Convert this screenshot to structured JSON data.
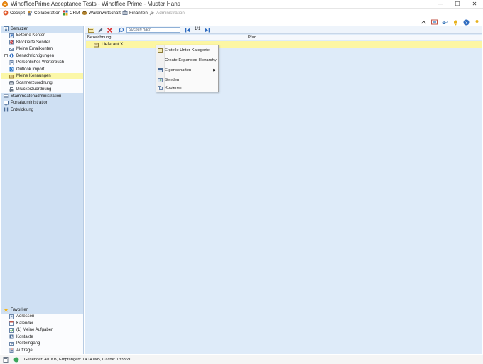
{
  "window": {
    "title": "WinofficePrime Acceptance Tests - Winoffice Prime - Muster Hans",
    "minimize": "—",
    "maximize": "☐",
    "close": "✕"
  },
  "modules": [
    {
      "label": "Cockpit",
      "icon": "cockpit-icon"
    },
    {
      "label": "Collaboration",
      "icon": "collaboration-icon"
    },
    {
      "label": "CRM",
      "icon": "crm-icon"
    },
    {
      "label": "Warenwirtschaft",
      "icon": "warenwirtschaft-icon"
    },
    {
      "label": "Finanzen",
      "icon": "finanzen-icon"
    },
    {
      "label": "Administration",
      "icon": "administration-icon",
      "disabled": true
    }
  ],
  "right_icons": [
    "chevron-up-icon",
    "screen-icon",
    "link-icon",
    "bell-icon",
    "help-icon",
    "pin-icon"
  ],
  "sidebar": {
    "benutzer": {
      "label": "Benutzer",
      "items": [
        {
          "label": "Externe Konten",
          "icon": "external-accounts-icon"
        },
        {
          "label": "Blockierte Sender",
          "icon": "blocked-senders-icon"
        },
        {
          "label": "Meine Emailkonten",
          "icon": "email-accounts-icon"
        },
        {
          "label": "Benachrichtigungen",
          "icon": "notifications-icon",
          "expandable": true
        },
        {
          "label": "Persönliches Wörterbuch",
          "icon": "dictionary-icon"
        },
        {
          "label": "Outlook Import",
          "icon": "outlook-import-icon"
        },
        {
          "label": "Meine Kennungen",
          "icon": "identifiers-icon",
          "selected": true
        },
        {
          "label": "Scannerzuordnung",
          "icon": "scanner-icon"
        },
        {
          "label": "Druckerzuordnung",
          "icon": "printer-icon"
        }
      ]
    },
    "groups": [
      {
        "label": "Stammdatenadministration",
        "icon": "master-data-icon"
      },
      {
        "label": "Portaladministration",
        "icon": "portal-icon"
      },
      {
        "label": "Entwicklung",
        "icon": "development-icon"
      }
    ],
    "favoriten": {
      "label": "Favoriten",
      "items": [
        {
          "label": "Adressen",
          "icon": "addresses-icon"
        },
        {
          "label": "Kalender",
          "icon": "calendar-icon"
        },
        {
          "label": "(1) Meine Aufgaben",
          "icon": "tasks-icon"
        },
        {
          "label": "Kontakte",
          "icon": "contacts-icon"
        },
        {
          "label": "Posteingang",
          "icon": "inbox-icon"
        },
        {
          "label": "Aufträge",
          "icon": "orders-icon"
        }
      ]
    }
  },
  "toolbar": {
    "search_placeholder": "Suchen nach",
    "pager": "1/1"
  },
  "grid": {
    "columns": [
      "Bezeichnung",
      "Pfad"
    ],
    "rows": [
      {
        "bezeichnung": "Lieferant X",
        "pfad": ""
      }
    ]
  },
  "context_menu": {
    "items": [
      {
        "label": "Erstelle Unter-Kategorie",
        "icon": "new-subcategory-icon"
      },
      {
        "label": "Create Expanded Hierarchy",
        "icon": ""
      },
      {
        "label": "Eigenschaften",
        "icon": "properties-icon",
        "submenu": true
      },
      {
        "label": "Senden",
        "icon": "send-icon"
      },
      {
        "label": "Kopieren",
        "icon": "copy-icon"
      }
    ]
  },
  "status": {
    "text": "Gesendet: 401KB, Empfangen: 14'141KB, Cache: 133369"
  },
  "colors": {
    "sidebar_bg": "#cfe0f3",
    "main_bg": "#deebf9",
    "selected_row": "#fcf6a3",
    "accent": "#1f5fa8"
  }
}
